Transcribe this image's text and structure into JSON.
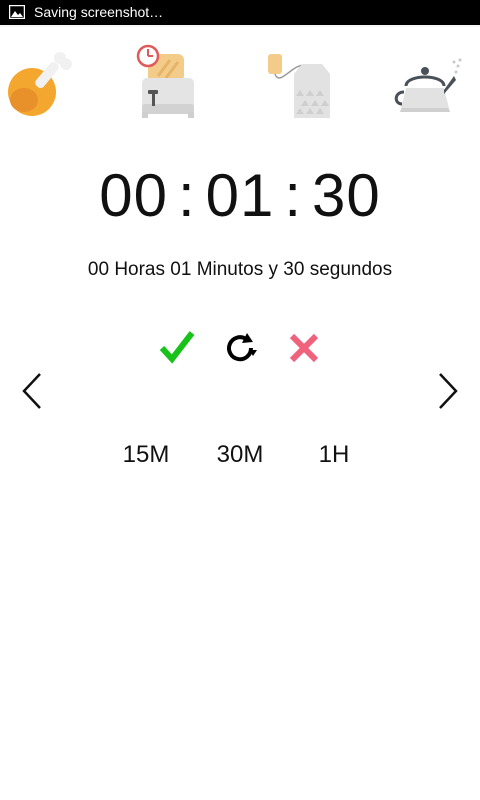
{
  "status_bar": {
    "notification_icon": "image-icon",
    "text": "Saving screenshot…"
  },
  "categories": [
    {
      "name": "chicken-leg-icon"
    },
    {
      "name": "toaster-icon"
    },
    {
      "name": "tea-bag-icon"
    },
    {
      "name": "kettle-icon"
    }
  ],
  "timer": {
    "hours": "00",
    "minutes": "01",
    "seconds": "30",
    "separator": ":",
    "text": "00 Horas 01 Minutos y 30 segundos"
  },
  "controls": {
    "confirm_icon": "check-icon",
    "reset_icon": "refresh-icon",
    "cancel_icon": "close-icon",
    "prev_icon": "chevron-left-icon",
    "next_icon": "chevron-right-icon"
  },
  "presets": [
    "15M",
    "30M",
    "1H"
  ],
  "colors": {
    "check": "#19c21b",
    "cancel": "#f0627c",
    "chicken": "#f4a72e",
    "clock": "#e05a5a"
  }
}
